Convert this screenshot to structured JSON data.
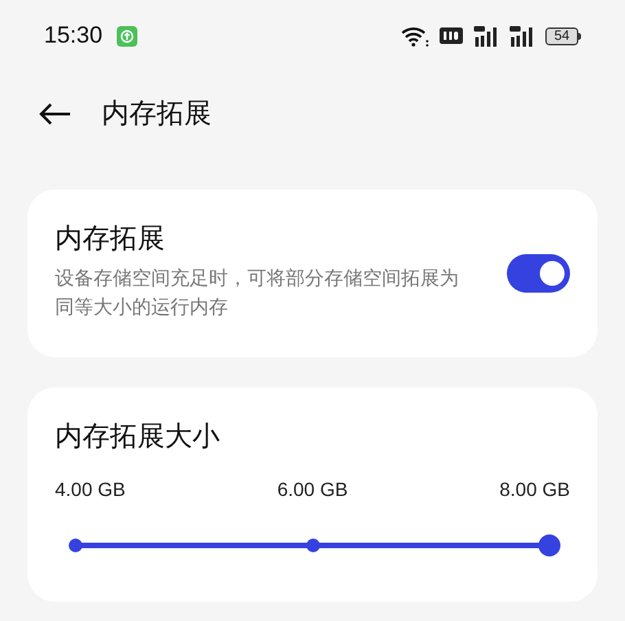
{
  "status_bar": {
    "time": "15:30",
    "battery": "54"
  },
  "header": {
    "title": "内存拓展"
  },
  "toggle_card": {
    "title": "内存拓展",
    "description": "设备存储空间充足时，可将部分存储空间拓展为同等大小的运行内存",
    "on": true
  },
  "size_card": {
    "title": "内存拓展大小",
    "options": [
      {
        "label": "4.00 GB"
      },
      {
        "label": "6.00 GB"
      },
      {
        "label": "8.00 GB"
      }
    ],
    "level": 1
  }
}
